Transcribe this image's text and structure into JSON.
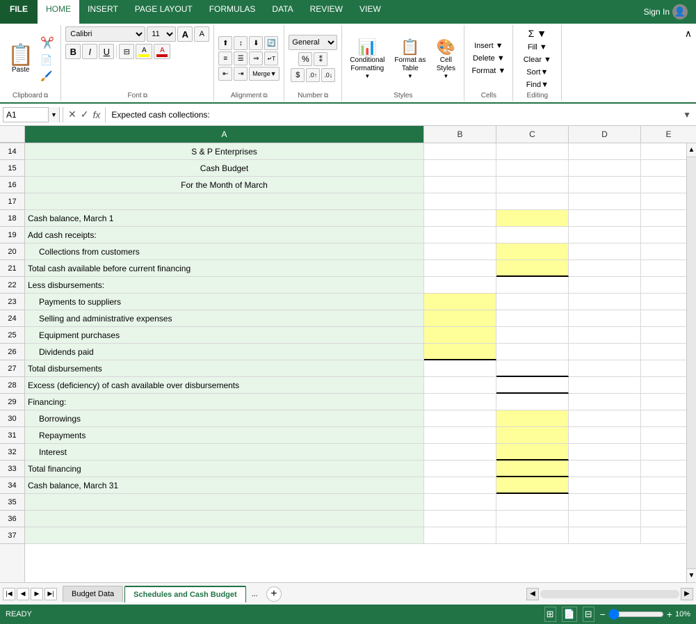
{
  "ribbon": {
    "tabs": [
      "FILE",
      "HOME",
      "INSERT",
      "PAGE LAYOUT",
      "FORMULAS",
      "DATA",
      "REVIEW",
      "VIEW"
    ],
    "active_tab": "HOME",
    "sign_in": "Sign In",
    "groups": {
      "clipboard": {
        "label": "Clipboard",
        "paste": "Paste"
      },
      "font": {
        "label": "Font",
        "font_name": "Calibri",
        "font_size": "11",
        "bold": "B",
        "italic": "I",
        "underline": "U"
      },
      "alignment": {
        "label": "Alignment",
        "btn": "Alignment"
      },
      "number": {
        "label": "Number",
        "btn": "Number"
      },
      "styles": {
        "label": "Styles",
        "conditional": "Conditional\nFormatting",
        "format_table": "Format as\nTable",
        "cell_styles": "Cell\nStyles"
      },
      "cells": {
        "label": "Cells",
        "btn": "Cells"
      },
      "editing": {
        "label": "Editing",
        "btn": "Editing"
      }
    }
  },
  "formula_bar": {
    "cell_ref": "A1",
    "formula_content": "Expected cash collections:"
  },
  "columns": [
    {
      "id": "A",
      "label": "A",
      "selected": true
    },
    {
      "id": "B",
      "label": "B"
    },
    {
      "id": "C",
      "label": "C"
    },
    {
      "id": "D",
      "label": "D"
    },
    {
      "id": "E",
      "label": "E"
    }
  ],
  "rows": [
    {
      "num": 14,
      "a": "S & P Enterprises",
      "a_align": "center",
      "b": "",
      "c": "",
      "d": "",
      "e": ""
    },
    {
      "num": 15,
      "a": "Cash Budget",
      "a_align": "center",
      "b": "",
      "c": "",
      "d": "",
      "e": ""
    },
    {
      "num": 16,
      "a": "For the Month of March",
      "a_align": "center",
      "b": "",
      "c": "",
      "d": "",
      "e": ""
    },
    {
      "num": 17,
      "a": "",
      "b": "",
      "c": "",
      "d": "",
      "e": ""
    },
    {
      "num": 18,
      "a": "Cash balance, March 1",
      "b": "",
      "c": "",
      "c_yellow": true,
      "d": "",
      "e": ""
    },
    {
      "num": 19,
      "a": "Add cash receipts:",
      "b": "",
      "c": "",
      "d": "",
      "e": ""
    },
    {
      "num": 20,
      "a": "   Collections from customers",
      "b": "",
      "c": "",
      "c_yellow": true,
      "d": "",
      "e": ""
    },
    {
      "num": 21,
      "a": "Total cash available before current financing",
      "b": "",
      "c": "",
      "c_yellow": true,
      "c_border_bottom": true,
      "d": "",
      "e": ""
    },
    {
      "num": 22,
      "a": "Less disbursements:",
      "b": "",
      "c": "",
      "d": "",
      "e": ""
    },
    {
      "num": 23,
      "a": "   Payments to suppliers",
      "b": "",
      "b_yellow": true,
      "c": "",
      "d": "",
      "e": ""
    },
    {
      "num": 24,
      "a": "   Selling and administrative expenses",
      "b": "",
      "b_yellow": true,
      "c": "",
      "d": "",
      "e": ""
    },
    {
      "num": 25,
      "a": "   Equipment purchases",
      "b": "",
      "b_yellow": true,
      "c": "",
      "d": "",
      "e": ""
    },
    {
      "num": 26,
      "a": "   Dividends paid",
      "b": "",
      "b_yellow": true,
      "b_border_bottom": true,
      "c": "",
      "d": "",
      "e": ""
    },
    {
      "num": 27,
      "a": "Total disbursements",
      "b": "",
      "c": "",
      "c_border_bottom": true,
      "d": "",
      "e": ""
    },
    {
      "num": 28,
      "a": "Excess (deficiency) of cash available over disbursements",
      "b": "",
      "c": "",
      "c_border_bottom": true,
      "d": "",
      "e": ""
    },
    {
      "num": 29,
      "a": "Financing:",
      "b": "",
      "c": "",
      "d": "",
      "e": ""
    },
    {
      "num": 30,
      "a": "   Borrowings",
      "b": "",
      "c": "",
      "c_yellow": true,
      "d": "",
      "e": ""
    },
    {
      "num": 31,
      "a": "   Repayments",
      "b": "",
      "c": "",
      "c_yellow": true,
      "d": "",
      "e": ""
    },
    {
      "num": 32,
      "a": "   Interest",
      "b": "",
      "c": "",
      "c_yellow": true,
      "c_border_bottom": true,
      "d": "",
      "e": ""
    },
    {
      "num": 33,
      "a": "Total financing",
      "b": "",
      "c": "",
      "c_yellow": true,
      "c_border_bottom": true,
      "d": "",
      "e": ""
    },
    {
      "num": 34,
      "a": "Cash balance, March 31",
      "b": "",
      "c": "",
      "c_yellow": true,
      "c_border_bottom": true,
      "d": "",
      "e": ""
    },
    {
      "num": 35,
      "a": "",
      "b": "",
      "c": "",
      "d": "",
      "e": ""
    },
    {
      "num": 36,
      "a": "",
      "b": "",
      "c": "",
      "d": "",
      "e": ""
    },
    {
      "num": 37,
      "a": "",
      "b": "",
      "c": "",
      "d": "",
      "e": ""
    }
  ],
  "sheet_tabs": [
    {
      "label": "Budget Data",
      "active": false
    },
    {
      "label": "Schedules and Cash Budget",
      "active": true
    }
  ],
  "status": {
    "ready": "READY",
    "zoom": "10%"
  }
}
